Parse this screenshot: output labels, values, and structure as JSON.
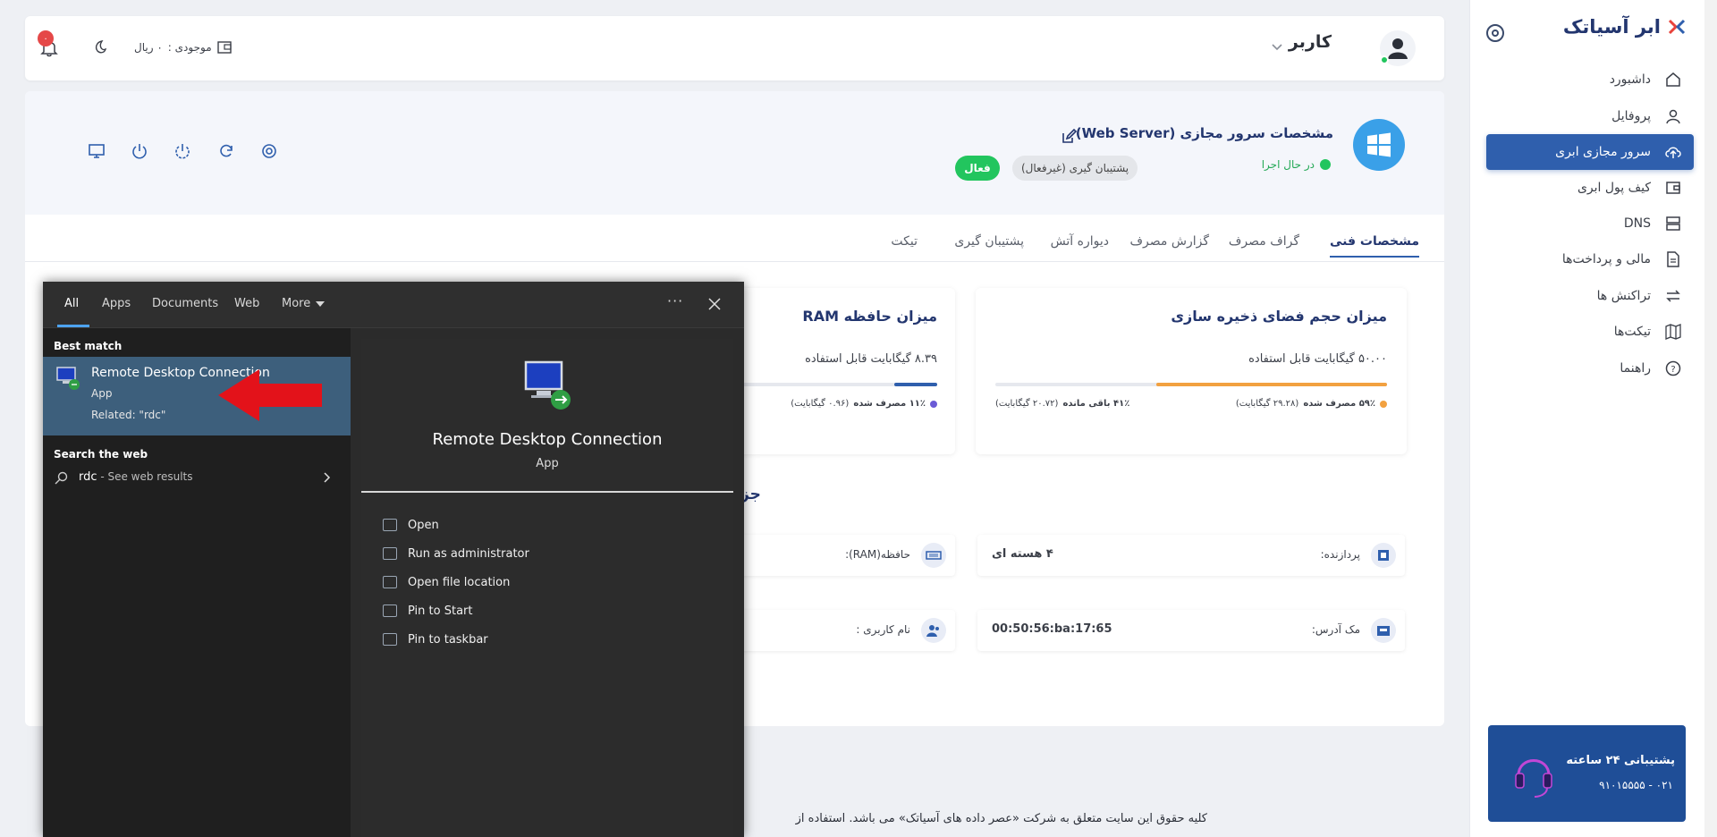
{
  "sidebar": {
    "brand": "ابر آسیاتک",
    "items": [
      {
        "label": "داشبورد",
        "icon": "home-icon"
      },
      {
        "label": "پروفایل",
        "icon": "user-icon"
      },
      {
        "label": "سرور مجازی ابری",
        "icon": "cloud-upload-icon",
        "active": true
      },
      {
        "label": "کیف پول ابری",
        "icon": "wallet-icon"
      },
      {
        "label": "DNS",
        "icon": "server-icon"
      },
      {
        "label": "مالی و پرداخت‌ها",
        "icon": "document-icon"
      },
      {
        "label": "تراکنش ها",
        "icon": "transfer-icon"
      },
      {
        "label": "تیکت‌ها",
        "icon": "map-icon"
      },
      {
        "label": "راهنما",
        "icon": "help-icon"
      }
    ],
    "support": {
      "title": "پشتیبانی ۲۴ ساعته",
      "phone": "۰۲۱ - ۹۱۰۱۵۵۵۵"
    }
  },
  "topbar": {
    "username": "کاربر",
    "balance_label": "موجودی :",
    "balance_value": "۰ ریال",
    "notif_count": "۰"
  },
  "server": {
    "title": "مشخصات سرور مجازی (Web Server)",
    "status": "در حال اجرا",
    "backup": "پشتیبان گیری (غیرفعال)",
    "active_btn": "فعال‌"
  },
  "tabs": [
    "مشخصات فنی",
    "گراف مصرف",
    "گزارش مصرف",
    "دیواره آتش",
    "پشتیبان گیری",
    "تیکت"
  ],
  "storage": {
    "title": "میزان حجم فضای ذخیره سازی",
    "available": "۵۰.۰۰ گیگابایت قابل استفاده",
    "used": "۵۹٪ مصرف شده",
    "used_detail": "(۲۹.۲۸ گیگابایت)",
    "remain": "۴۱٪ باقی مانده",
    "remain_detail": "(۲۰.۷۲ گیگابایت)",
    "used_fraction": 0.59,
    "accent": "#f2a140"
  },
  "ram": {
    "title": "میزان حافظه RAM",
    "available": "۸.۳۹ گیگابایت قابل استفاده",
    "used": "۱۱٪ مصرف شده",
    "used_detail": "(۰.۹۶ گیگابایت)",
    "used_fraction": 0.11,
    "accent": "#2f5fad"
  },
  "section_fragment": "جز",
  "specs": {
    "cpu_label": "پردازنده:",
    "cpu_value": "۴ هسته ای",
    "ram_label": "حافظه(RAM):",
    "mac_label": "مک آدرس:",
    "mac_value": "00:50:56:ba:17:65",
    "user_label": "نام کاربری :"
  },
  "footer": "کلیه حقوق این سایت متعلق به شرکت «عصر داده های آسیاتک» می باشد. استفاده از",
  "search": {
    "tabs": [
      "All",
      "Apps",
      "Documents",
      "Web",
      "More"
    ],
    "best_match_heading": "Best match",
    "result_title": "Remote Desktop Connection",
    "result_type": "App",
    "result_related": "Related: \"rdc\"",
    "web_heading": "Search the web",
    "web_query": "rdc",
    "web_suffix": " - See web results",
    "preview_title": "Remote Desktop Connection",
    "preview_type": "App",
    "actions": [
      "Open",
      "Run as administrator",
      "Open file location",
      "Pin to Start",
      "Pin to taskbar"
    ]
  },
  "colors": {
    "brand_blue": "#2f5fad",
    "status_green": "#22c55e",
    "arrow_red": "#e3121a"
  }
}
